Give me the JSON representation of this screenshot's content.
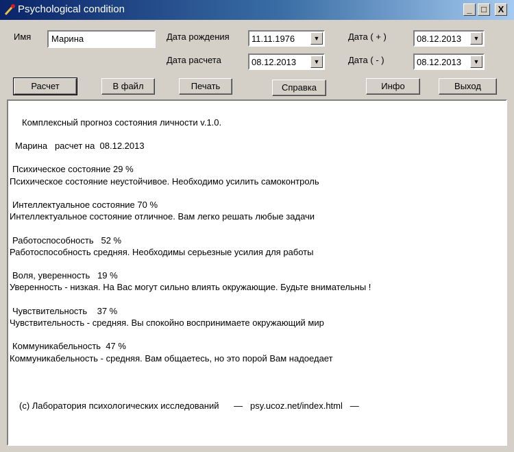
{
  "window": {
    "title": "Psychological condition",
    "minimize": "_",
    "maximize": "□",
    "close": "X"
  },
  "form": {
    "name_label": "Имя",
    "name_value": "Марина",
    "birth_label": "Дата рождения",
    "birth_value": "11.11.1976",
    "calc_label": "Дата расчета",
    "calc_value": "08.12.2013",
    "plus_label": "Дата ( + )",
    "plus_value": "08.12.2013",
    "minus_label": "Дата ( - )",
    "minus_value": "08.12.2013",
    "dropdown_arrow": "▼"
  },
  "buttons": {
    "calc": "Расчет",
    "file": "В файл",
    "print": "Печать",
    "help": "Справка",
    "info": "Инфо",
    "exit": "Выход"
  },
  "report": {
    "header": "Комплексный прогноз состояния личности v.1.0.",
    "subheader": "Марина   расчет на  08.12.2013",
    "sections": [
      {
        "title": "Психическое состояние 29 %",
        "text": "Психическое состояние неустойчивое. Необходимо усилить самоконтроль"
      },
      {
        "title": "Интеллектуальное состояние 70 %",
        "text": "Интеллектуальное состояние отличное. Вам легко решать любые задачи"
      },
      {
        "title": "Работоспособность   52 %",
        "text": "Работоспособность средняя. Необходимы серьезные усилия для работы"
      },
      {
        "title": "Воля, уверенность   19 %",
        "text": "Уверенность - низкая. На Вас могут сильно влиять окружающие. Будьте внимательны !"
      },
      {
        "title": "Чувствительность    37 %",
        "text": "Чувствительность - средняя. Вы спокойно воспринимаете окружающий мир"
      },
      {
        "title": "Коммуникабельность  47 %",
        "text": "Коммуникабельность - средняя. Вам общаетесь, но это порой Вам надоедает"
      }
    ],
    "footer": "(c) Лаборатория психологических исследований      —   psy.ucoz.net/index.html   —"
  }
}
